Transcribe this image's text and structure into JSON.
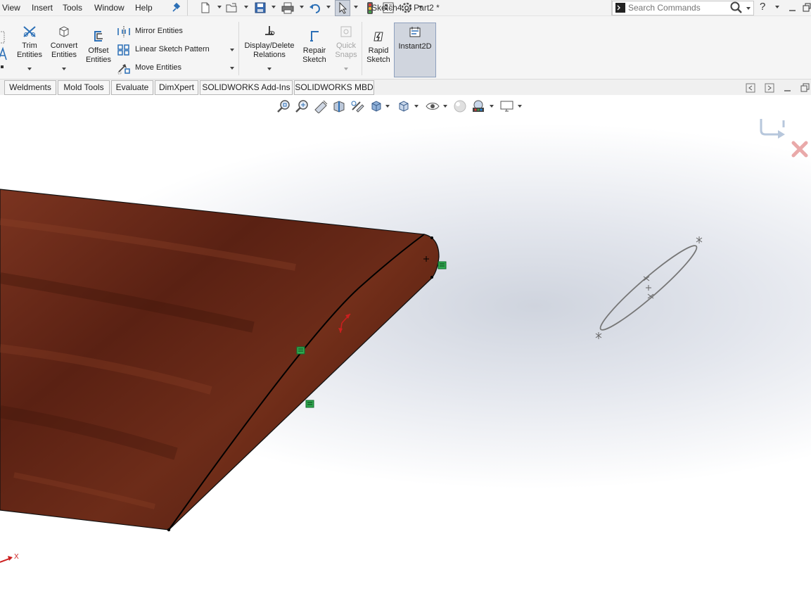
{
  "menu": {
    "items": [
      "View",
      "Insert",
      "Tools",
      "Window",
      "Help"
    ]
  },
  "document": {
    "title": "Sketch4 of Part2 *"
  },
  "search": {
    "placeholder": "Search Commands"
  },
  "help": {
    "label": "?"
  },
  "ribbon": {
    "trim": {
      "line1": "Trim",
      "line2": "Entities"
    },
    "convert": {
      "line1": "Convert",
      "line2": "Entities"
    },
    "offset": {
      "line1": "Offset",
      "line2": "Entities"
    },
    "mirror": "Mirror Entities",
    "linear_pattern": "Linear Sketch Pattern",
    "move": "Move Entities",
    "display_delete": {
      "line1": "Display/Delete",
      "line2": "Relations"
    },
    "repair": {
      "line1": "Repair",
      "line2": "Sketch"
    },
    "quick_snaps": {
      "line1": "Quick",
      "line2": "Snaps"
    },
    "rapid_sketch": {
      "line1": "Rapid",
      "line2": "Sketch"
    },
    "instant2d": "Instant2D"
  },
  "tabs": [
    "Weldments",
    "Mold Tools",
    "Evaluate",
    "DimXpert",
    "SOLIDWORKS Add-Ins",
    "SOLIDWORKS MBD"
  ],
  "viewport": {
    "axis_label": "X",
    "icons": [
      "zoom-to-fit-icon",
      "zoom-to-area-icon",
      "previous-view-icon",
      "section-view-icon",
      "dynamic-annotation-icon",
      "view-orientation-icon",
      "display-style-icon",
      "hide-show-items-icon",
      "edit-appearance-icon",
      "apply-scene-icon",
      "view-settings-icon"
    ],
    "confirm_corner": [
      "exit-sketch-icon",
      "cancel-sketch-icon"
    ]
  },
  "colors": {
    "wood_dark": "#4a1a0e",
    "wood_light": "#8a3e26",
    "sketch_relation": "#2fa84f",
    "axis_red": "#cc1f1f",
    "selected_button": "#d0d5de"
  }
}
